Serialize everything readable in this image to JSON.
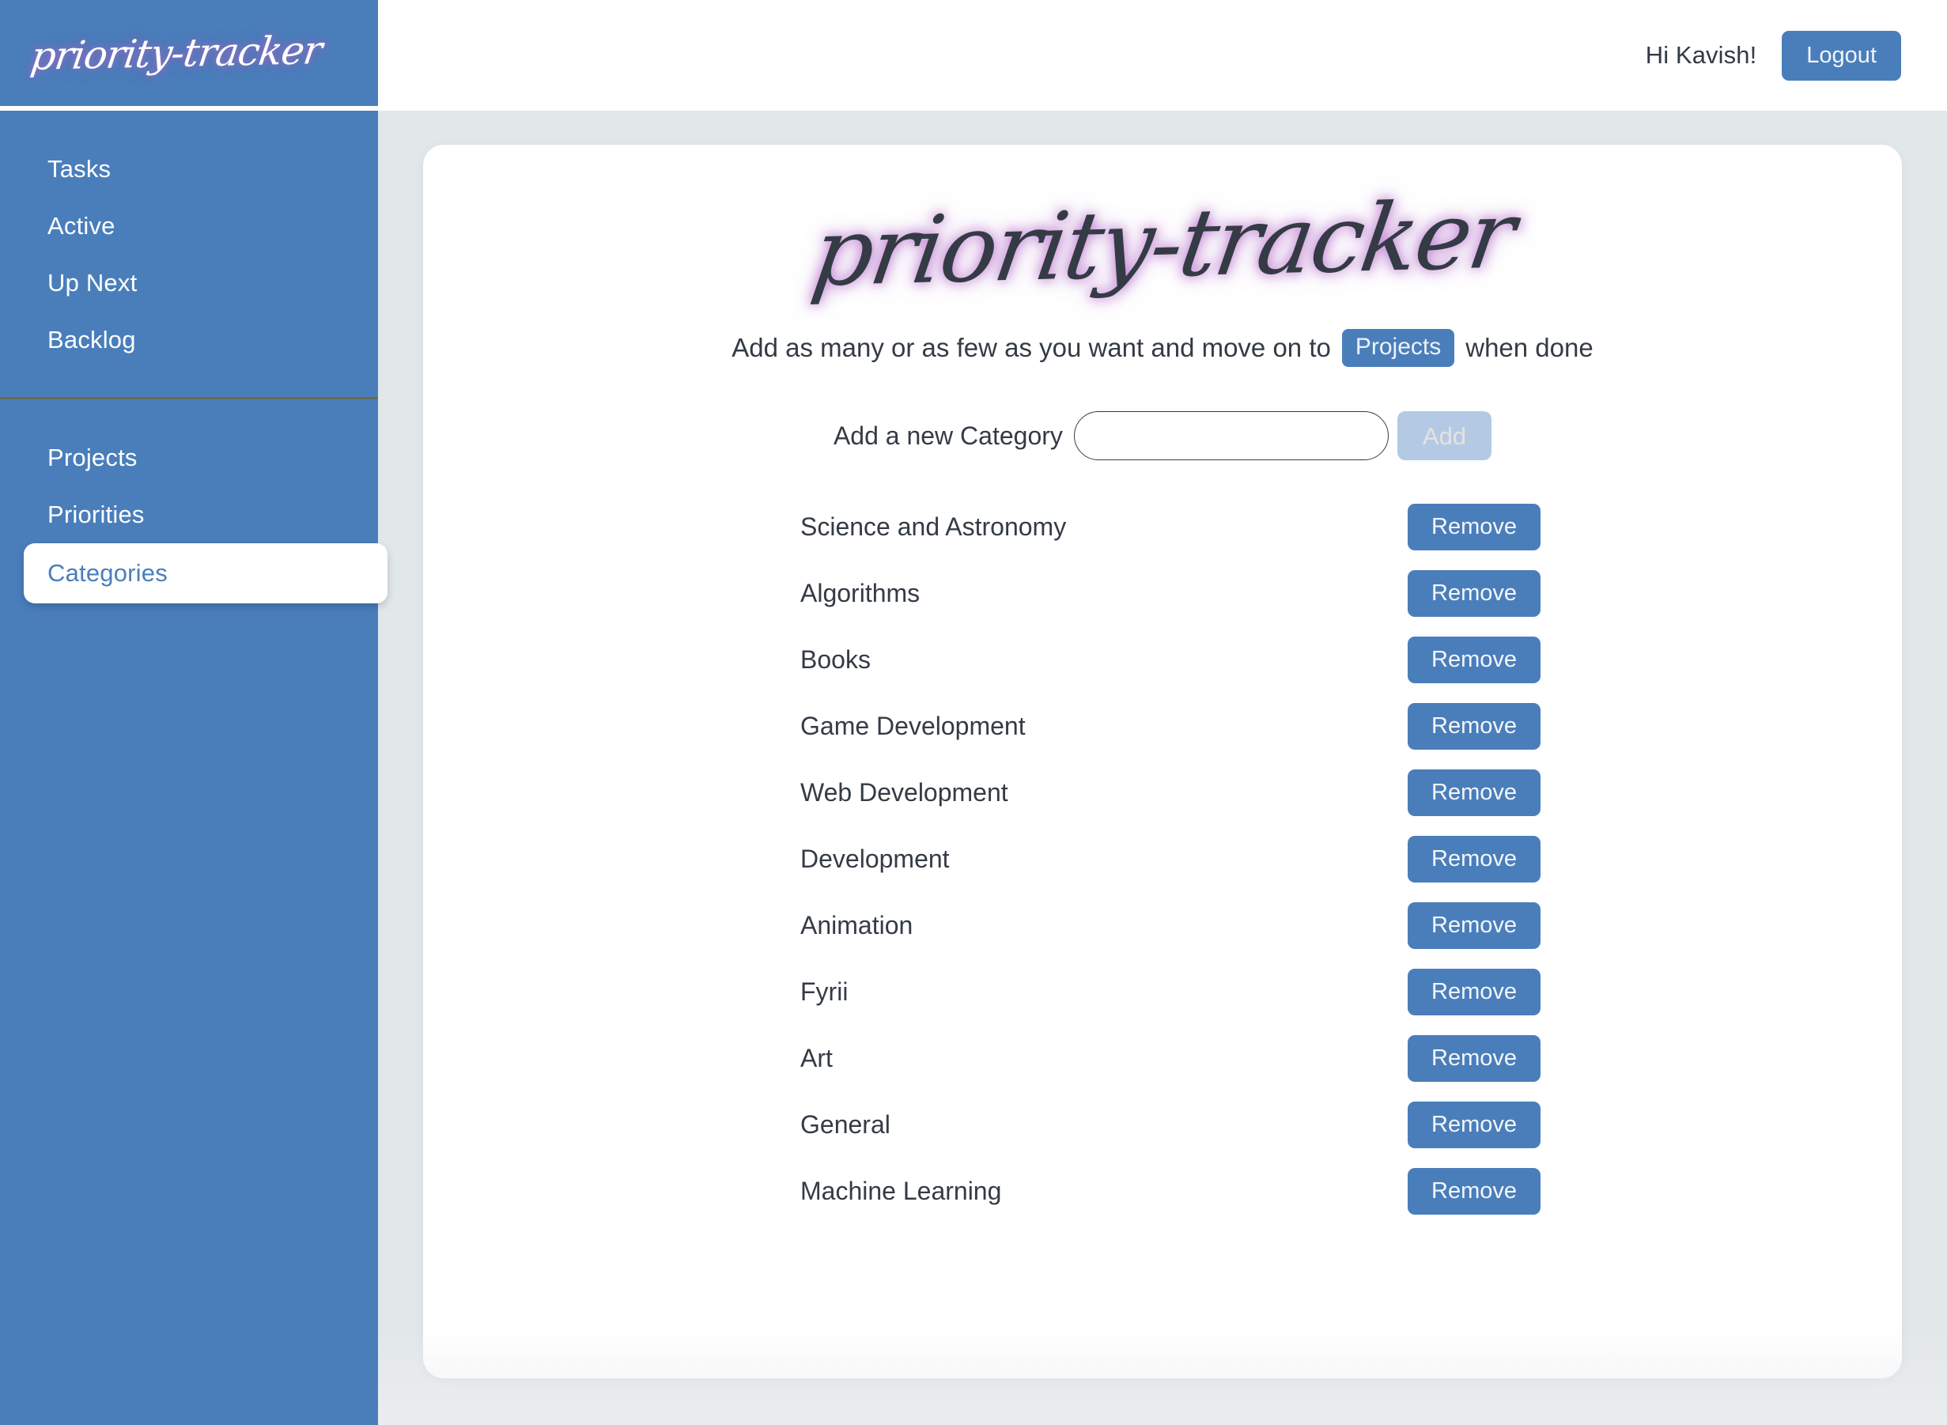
{
  "brand": {
    "sidebar_logo": "priority-tracker",
    "page_logo": "priority-tracker"
  },
  "header": {
    "greeting": "Hi Kavish!",
    "logout_label": "Logout"
  },
  "sidebar": {
    "group_tasks": [
      {
        "label": "Tasks",
        "active": false
      },
      {
        "label": "Active",
        "active": false
      },
      {
        "label": "Up Next",
        "active": false
      },
      {
        "label": "Backlog",
        "active": false
      }
    ],
    "group_planning": [
      {
        "label": "Projects",
        "active": false
      },
      {
        "label": "Priorities",
        "active": false
      },
      {
        "label": "Categories",
        "active": true
      }
    ]
  },
  "main": {
    "subtitle_before": "Add as many or as few as you want and move on to",
    "subtitle_chip": "Projects",
    "subtitle_after": "when done",
    "form": {
      "label": "Add a new Category",
      "input_value": "",
      "input_placeholder": "",
      "add_label": "Add",
      "add_disabled": true
    },
    "remove_label": "Remove",
    "categories": [
      "Science and Astronomy",
      "Algorithms",
      "Books",
      "Game Development",
      "Web Development",
      "Development",
      "Animation",
      "Fyrii",
      "Art",
      "General",
      "Machine Learning"
    ]
  },
  "colors": {
    "brand_blue": "#4a7ebb",
    "content_bg": "#e2e7ea",
    "card_bg": "#ffffff",
    "text_dark": "#343b45",
    "disabled_blue": "#b4cae4",
    "logo_glow": "#b06ac7",
    "divider": "#6a6a52"
  }
}
